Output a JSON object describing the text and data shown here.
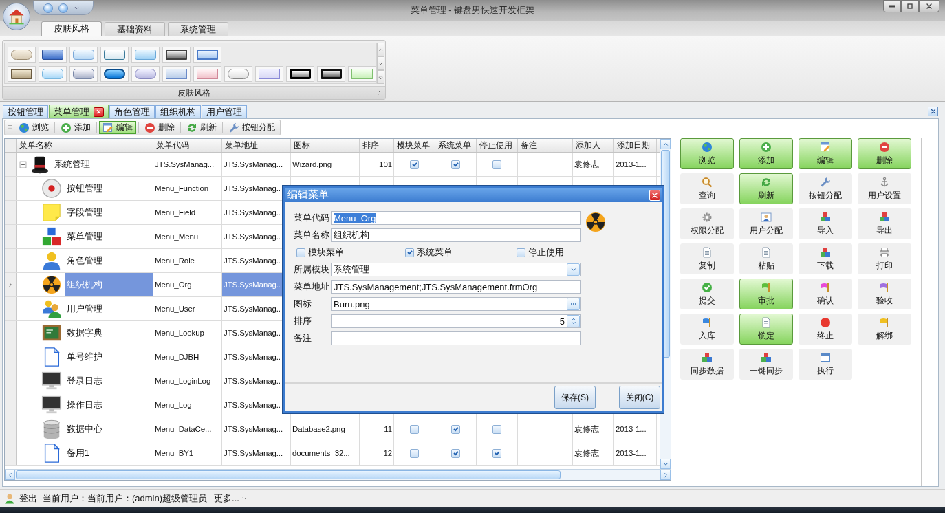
{
  "window": {
    "title": "菜单管理 - 键盘男快速开发框架"
  },
  "ribbon": {
    "tabs": [
      {
        "label": "皮肤风格",
        "selected": true
      },
      {
        "label": "基础资料",
        "selected": false
      },
      {
        "label": "系统管理",
        "selected": false
      }
    ],
    "group_caption": "皮肤风格"
  },
  "document_tabs": [
    {
      "label": "按钮管理",
      "selected": false,
      "closable": false
    },
    {
      "label": "菜单管理",
      "selected": true,
      "closable": true
    },
    {
      "label": "角色管理",
      "selected": false,
      "closable": false
    },
    {
      "label": "组织机构",
      "selected": false,
      "closable": false
    },
    {
      "label": "用户管理",
      "selected": false,
      "closable": false
    }
  ],
  "toolbar": [
    {
      "label": "浏览",
      "selected": false
    },
    {
      "label": "添加",
      "selected": false
    },
    {
      "label": "编辑",
      "selected": true
    },
    {
      "label": "删除",
      "selected": false
    },
    {
      "label": "刷新",
      "selected": false
    },
    {
      "label": "按钮分配",
      "selected": false
    }
  ],
  "grid": {
    "columns": [
      "菜单名称",
      "菜单代码",
      "菜单地址",
      "图标",
      "排序",
      "模块菜单",
      "系统菜单",
      "停止使用",
      "备注",
      "添加人",
      "添加日期"
    ],
    "rows": [
      {
        "name": "系统管理",
        "code": "JTS.SysManag...",
        "address": "JTS.SysManag...",
        "icon": "Wizard.png",
        "sort": "101",
        "module_menu": true,
        "system_menu": true,
        "stopped": false,
        "added_by": "袁修志",
        "added_date": "2013-1...",
        "selected": false,
        "expanded": true,
        "children": [
          {
            "name": "按钮管理",
            "code": "Menu_Function",
            "address": "JTS.SysManag..",
            "selected": false
          },
          {
            "name": "字段管理",
            "code": "Menu_Field",
            "address": "JTS.SysManag..",
            "selected": false
          },
          {
            "name": "菜单管理",
            "code": "Menu_Menu",
            "address": "JTS.SysManag..",
            "selected": false
          },
          {
            "name": "角色管理",
            "code": "Menu_Role",
            "address": "JTS.SysManag..",
            "selected": false
          },
          {
            "name": "组织机构",
            "code": "Menu_Org",
            "address": "JTS.SysManag..",
            "selected": true
          },
          {
            "name": "用户管理",
            "code": "Menu_User",
            "address": "JTS.SysManag..",
            "selected": false
          },
          {
            "name": "数据字典",
            "code": "Menu_Lookup",
            "address": "JTS.SysManag..",
            "selected": false
          },
          {
            "name": "单号维护",
            "code": "Menu_DJBH",
            "address": "JTS.SysManag..",
            "selected": false
          },
          {
            "name": "登录日志",
            "code": "Menu_LoginLog",
            "address": "JTS.SysManag..",
            "selected": false
          },
          {
            "name": "操作日志",
            "code": "Menu_Log",
            "address": "JTS.SysManag..",
            "selected": false
          },
          {
            "name": "数据中心",
            "code": "Menu_DataCe...",
            "address": "JTS.SysManag...",
            "icon": "Database2.png",
            "sort": "11",
            "module_menu": false,
            "system_menu": true,
            "stopped": false,
            "added_by": "袁修志",
            "added_date": "2013-1...",
            "selected": false
          },
          {
            "name": "备用1",
            "code": "Menu_BY1",
            "address": "JTS.SysManag...",
            "icon": "documents_32...",
            "sort": "12",
            "module_menu": false,
            "system_menu": true,
            "stopped": true,
            "added_by": "袁修志",
            "added_date": "2013-1...",
            "selected": false
          }
        ]
      }
    ]
  },
  "dialog": {
    "title": "编辑菜单",
    "fields": [
      {
        "kind": "text",
        "label": "菜单代码",
        "value": "Menu_Org",
        "text_selected": true
      },
      {
        "kind": "text",
        "label": "菜单名称",
        "value": "组织机构",
        "text_selected": false
      },
      {
        "kind": "checks",
        "items": [
          {
            "label": "模块菜单",
            "checked": false
          },
          {
            "label": "系统菜单",
            "checked": true
          },
          {
            "label": "停止使用",
            "checked": false
          }
        ]
      },
      {
        "kind": "dropdown",
        "label": "所属模块",
        "value": "系统管理"
      },
      {
        "kind": "text",
        "label": "菜单地址",
        "value": "JTS.SysManagement;JTS.SysManagement.frmOrg",
        "text_selected": false
      },
      {
        "kind": "browse",
        "label": "图标",
        "value": "Burn.png"
      },
      {
        "kind": "spinner",
        "label": "排序",
        "value": "5"
      },
      {
        "kind": "text",
        "label": "备注"
      }
    ],
    "buttons": [
      "保存(S)",
      "关闭(C)"
    ]
  },
  "action_buttons": [
    {
      "label": "浏览",
      "highlighted": true
    },
    {
      "label": "添加",
      "highlighted": true
    },
    {
      "label": "编辑",
      "highlighted": true
    },
    {
      "label": "删除",
      "highlighted": true
    },
    {
      "label": "查询",
      "highlighted": false
    },
    {
      "label": "刷新",
      "highlighted": true
    },
    {
      "label": "按钮分配",
      "highlighted": false
    },
    {
      "label": "用户设置",
      "highlighted": false
    },
    {
      "label": "权限分配",
      "highlighted": false
    },
    {
      "label": "用户分配",
      "highlighted": false
    },
    {
      "label": "导入",
      "highlighted": false
    },
    {
      "label": "导出",
      "highlighted": false
    },
    {
      "label": "复制",
      "highlighted": false
    },
    {
      "label": "粘贴",
      "highlighted": false
    },
    {
      "label": "下载",
      "highlighted": false
    },
    {
      "label": "打印",
      "highlighted": false
    },
    {
      "label": "提交",
      "highlighted": false
    },
    {
      "label": "审批",
      "highlighted": true
    },
    {
      "label": "确认",
      "highlighted": false
    },
    {
      "label": "验收",
      "highlighted": false
    },
    {
      "label": "入库",
      "highlighted": false
    },
    {
      "label": "锁定",
      "highlighted": true
    },
    {
      "label": "终止",
      "highlighted": false
    },
    {
      "label": "解绑",
      "highlighted": false
    },
    {
      "label": "同步数据",
      "highlighted": false
    },
    {
      "label": "一键同步",
      "highlighted": false
    },
    {
      "label": "执行",
      "highlighted": false
    }
  ],
  "status_bar": {
    "logout": "登出",
    "user": "当前用户：当前用户：(admin)超级管理员",
    "more": "更多..."
  }
}
